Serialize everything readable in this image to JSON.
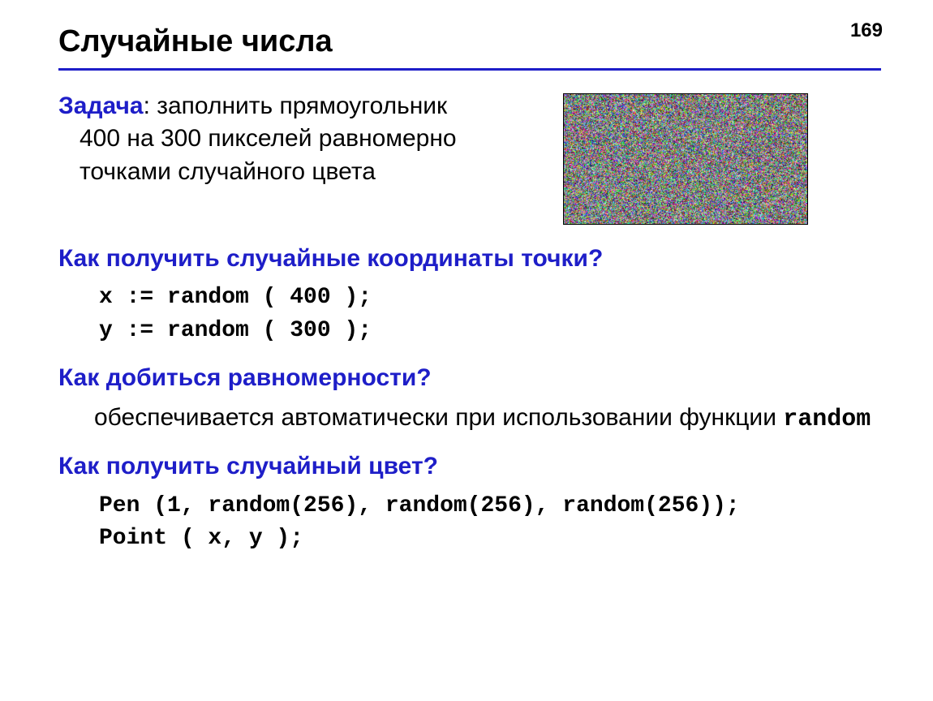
{
  "page_number": "169",
  "title": "Случайные числа",
  "task": {
    "label": "Задача",
    "text_line1": ": заполнить прямоугольник",
    "text_rest": "400 на 300 пикселей равномерно точками случайного цвета"
  },
  "noise_image": {
    "width_css": 300,
    "height_css": 160
  },
  "q1": {
    "heading": "Как получить случайные координаты точки?",
    "code1": "x := random ( 400 );",
    "code2": "y := random ( 300 );"
  },
  "q2": {
    "heading": "Как добиться равномерности?",
    "answer_pre": "обеспечивается автоматически при использовании функции ",
    "answer_mono": "random"
  },
  "q3": {
    "heading": "Как получить случайный цвет?",
    "code1": "Pen (1, random(256), random(256), random(256));",
    "code2": "Point ( x, y );"
  }
}
